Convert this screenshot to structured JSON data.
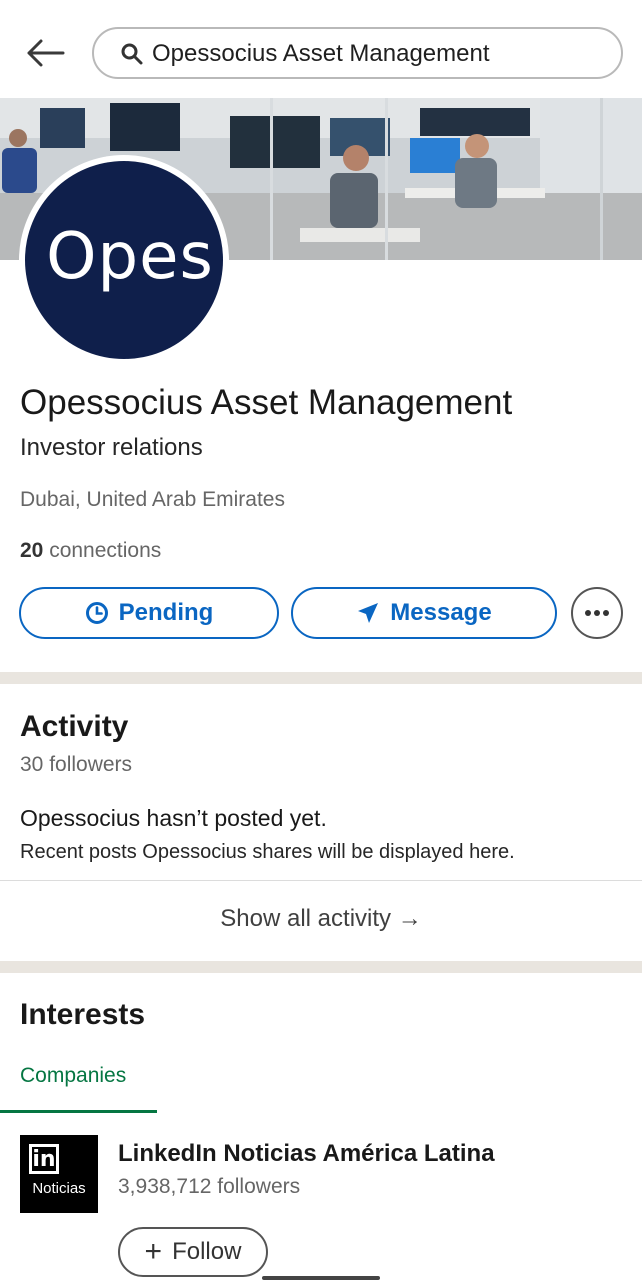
{
  "search": {
    "query": "Opessocius Asset Management"
  },
  "profile": {
    "avatar_text": "Opes",
    "name": "Opessocius Asset Management",
    "headline": "Investor relations",
    "location": "Dubai, United Arab Emirates",
    "connections_count": "20",
    "connections_label": " connections"
  },
  "actions": {
    "pending_label": "Pending",
    "message_label": "Message",
    "accent_color": "#0a66c2"
  },
  "activity": {
    "title": "Activity",
    "followers": "30 followers",
    "empty_title": "Opessocius hasn’t posted yet.",
    "empty_text": "Recent posts Opessocius shares will be displayed here.",
    "show_all_label": "Show all activity →"
  },
  "interests": {
    "title": "Interests",
    "tabs": [
      {
        "label": "Companies",
        "selected": true
      }
    ],
    "accent_color": "#057642",
    "items": [
      {
        "logo_mark": "in",
        "logo_text": "Noticias",
        "name": "LinkedIn Noticias América Latina",
        "followers": "3,938,712 followers",
        "follow_label": "Follow"
      }
    ]
  },
  "icons": [
    "back-arrow-icon",
    "search-icon",
    "clock-icon",
    "send-icon",
    "more-icon",
    "plus-icon"
  ]
}
